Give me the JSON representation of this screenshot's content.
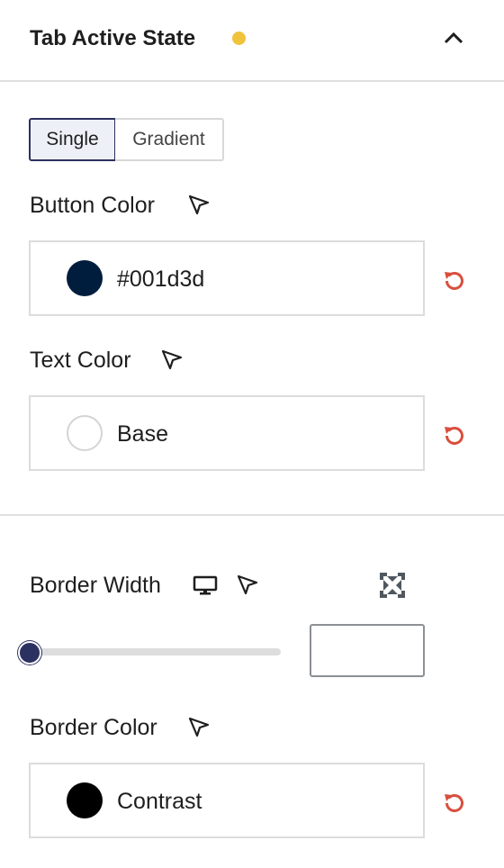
{
  "panel": {
    "title": "Tab Active State",
    "modified_color": "#f0c33c"
  },
  "tabs": {
    "single_label": "Single",
    "gradient_label": "Gradient",
    "selected": "Single"
  },
  "button_color": {
    "label": "Button Color",
    "swatch": "#001d3d",
    "value": "#001d3d"
  },
  "text_color": {
    "label": "Text Color",
    "swatch": "#ffffff",
    "value": "Base"
  },
  "border_width": {
    "label": "Border Width",
    "slider_value": 0,
    "input_value": ""
  },
  "border_color": {
    "label": "Border Color",
    "swatch": "#000000",
    "value": "Contrast"
  },
  "icons": {
    "collapse": "chevron-up-icon",
    "picker": "cursor-arrow-icon",
    "reset": "reset-icon",
    "device": "desktop-icon",
    "unlink": "unlink-sides-icon"
  },
  "colors": {
    "accent": "#2b3160",
    "reset": "#d94f3d"
  }
}
